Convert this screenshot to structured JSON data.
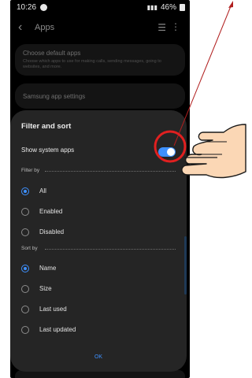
{
  "status_bar": {
    "time": "10:26",
    "right_text": "46%"
  },
  "app_bar": {
    "title": "Apps",
    "back_icon": "back-chevron-icon",
    "sort_icon": "filter-sort-icon",
    "more_icon": "more-vertical-icon"
  },
  "background": {
    "default_apps_title": "Choose default apps",
    "default_apps_subtitle": "Choose which apps to use for making calls, sending messages, going to websites, and more.",
    "samsung_settings": "Samsung app settings"
  },
  "sheet": {
    "title": "Filter and sort",
    "show_system_apps_label": "Show system apps",
    "show_system_apps_on": true,
    "filter_by_label": "Filter by",
    "filter_options": [
      {
        "label": "All",
        "selected": true
      },
      {
        "label": "Enabled",
        "selected": false
      },
      {
        "label": "Disabled",
        "selected": false
      }
    ],
    "sort_by_label": "Sort by",
    "sort_options": [
      {
        "label": "Name",
        "selected": true
      },
      {
        "label": "Size",
        "selected": false
      },
      {
        "label": "Last used",
        "selected": false
      },
      {
        "label": "Last updated",
        "selected": false
      }
    ],
    "ok_label": "OK"
  },
  "colors": {
    "accent": "#3e91ff",
    "sheet_bg": "#252525",
    "screen_bg": "#000000",
    "annotation_arrow": "#b01e1e",
    "annotation_circle": "#e02020",
    "hand_skin": "#fbd7b5"
  }
}
